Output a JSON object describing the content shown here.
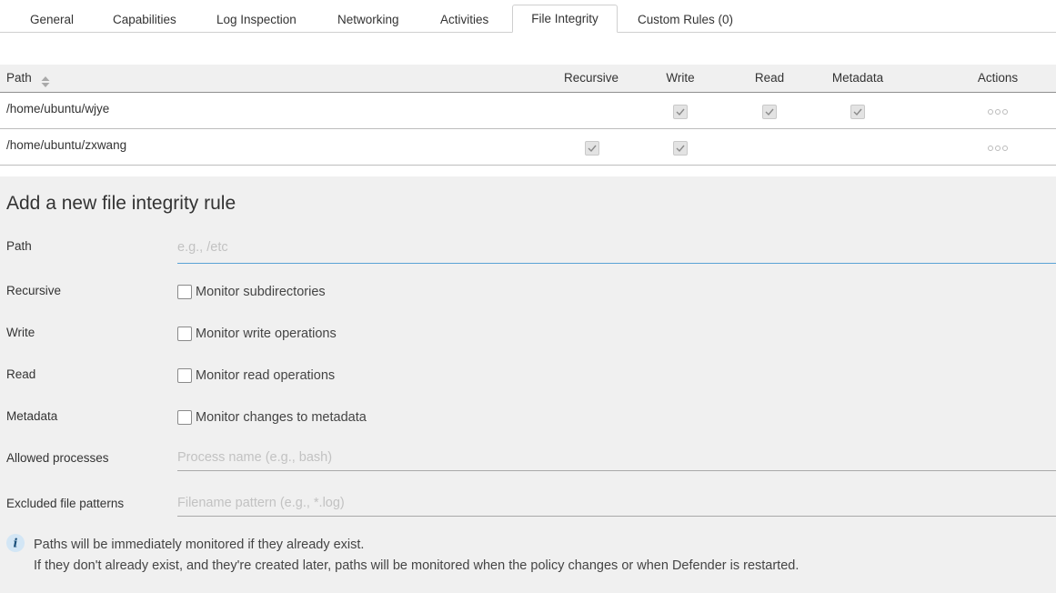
{
  "tabs": [
    {
      "label": "General"
    },
    {
      "label": "Capabilities"
    },
    {
      "label": "Log Inspection"
    },
    {
      "label": "Networking"
    },
    {
      "label": "Activities"
    },
    {
      "label": "File Integrity"
    },
    {
      "label": "Custom Rules (0)"
    }
  ],
  "active_tab": "File Integrity",
  "table": {
    "headers": {
      "path": "Path",
      "recursive": "Recursive",
      "write": "Write",
      "read": "Read",
      "metadata": "Metadata",
      "actions": "Actions"
    },
    "rows": [
      {
        "path": "/home/ubuntu/wjye",
        "recursive": false,
        "write": true,
        "read": true,
        "metadata": true
      },
      {
        "path": "/home/ubuntu/zxwang",
        "recursive": true,
        "write": true,
        "read": false,
        "metadata": false
      }
    ]
  },
  "form": {
    "title": "Add a new file integrity rule",
    "path_label": "Path",
    "path_placeholder": "e.g., /etc",
    "path_value": "",
    "recursive_label": "Recursive",
    "recursive_option": "Monitor subdirectories",
    "write_label": "Write",
    "write_option": "Monitor write operations",
    "read_label": "Read",
    "read_option": "Monitor read operations",
    "metadata_label": "Metadata",
    "metadata_option": "Monitor changes to metadata",
    "allowed_label": "Allowed processes",
    "allowed_placeholder": "Process name (e.g., bash)",
    "excluded_label": "Excluded file patterns",
    "excluded_placeholder": "Filename pattern (e.g., *.log)",
    "info_line1": "Paths will be immediately monitored if they already exist.",
    "info_line2": "If they don't already exist, and they're created later, paths will be monitored when the policy changes or when Defender is restarted."
  },
  "icons": {
    "sort": "sort-icon",
    "check": "check-icon",
    "actions": "more-dots-icon",
    "info": "info-icon"
  },
  "colors": {
    "focus_underline": "#5aa3d6",
    "panel_bg": "#f0f0f0",
    "info_icon_bg": "#d3e6f5"
  }
}
